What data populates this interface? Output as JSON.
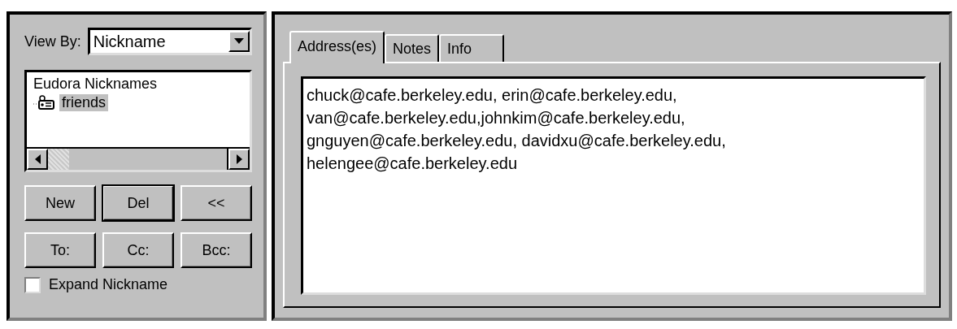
{
  "view_by": {
    "label": "View By:",
    "value": "Nickname"
  },
  "tree": {
    "root": "Eudora Nicknames",
    "children": [
      {
        "label": "friends",
        "selected": true
      }
    ]
  },
  "buttons_row_1": [
    "New",
    "Del",
    "<<"
  ],
  "buttons_row_2": [
    "To:",
    "Cc:",
    "Bcc:"
  ],
  "expand_nickname": {
    "label": "Expand Nickname",
    "checked": false
  },
  "tabs": [
    {
      "label": "Address(es)",
      "selected": true
    },
    {
      "label": "Notes",
      "selected": false
    },
    {
      "label": "Info",
      "selected": false
    }
  ],
  "addresses": "chuck@cafe.berkeley.edu, erin@cafe.berkeley.edu, van@cafe.berkeley.edu,johnkim@cafe.berkeley.edu, gnguyen@cafe.berkeley.edu, davidxu@cafe.berkeley.edu, helengee@cafe.berkeley.edu"
}
